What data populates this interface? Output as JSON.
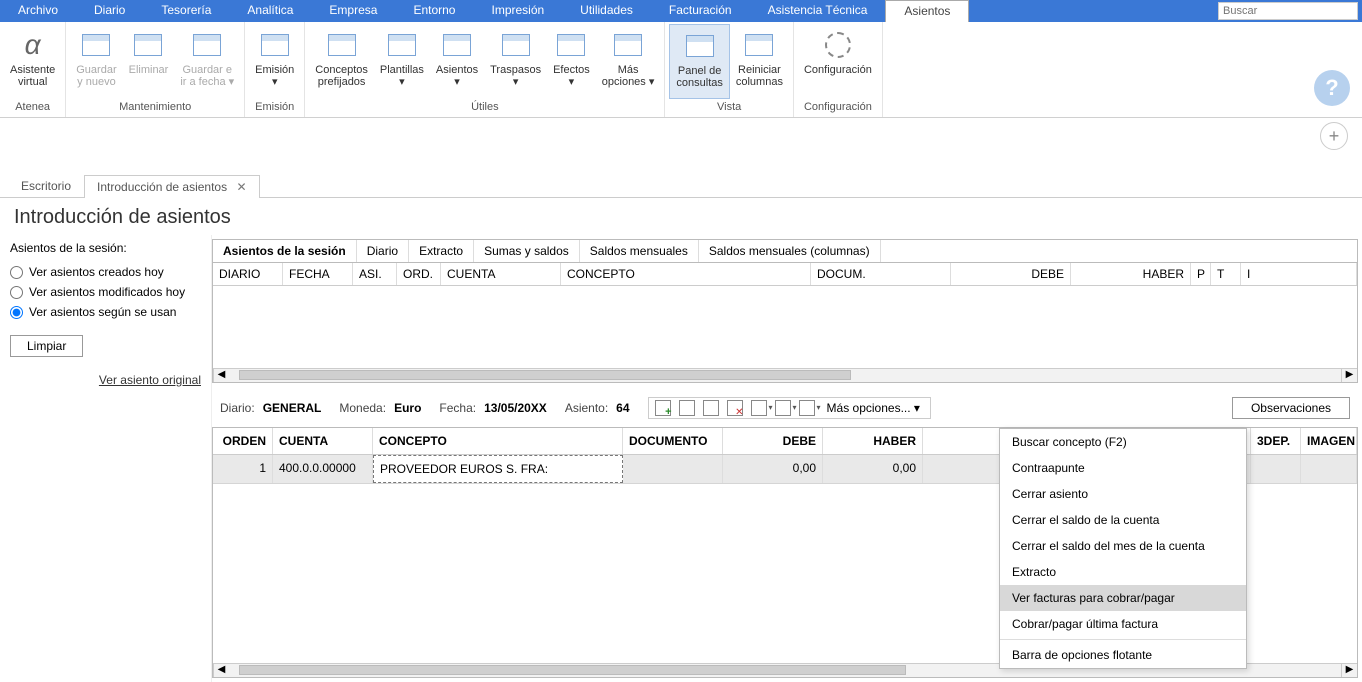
{
  "menubar": {
    "items": [
      "Archivo",
      "Diario",
      "Tesorería",
      "Analítica",
      "Empresa",
      "Entorno",
      "Impresión",
      "Utilidades",
      "Facturación",
      "Asistencia Técnica",
      "Asientos"
    ],
    "active_index": 10,
    "search_placeholder": "Buscar"
  },
  "ribbon": {
    "groups": [
      {
        "label": "Atenea",
        "buttons": [
          {
            "label": "Asistente\nvirtual",
            "icon": "alpha"
          }
        ]
      },
      {
        "label": "Mantenimiento",
        "buttons": [
          {
            "label": "Guardar\ny nuevo",
            "icon": "doc-plus",
            "disabled": true
          },
          {
            "label": "Eliminar",
            "icon": "doc-x",
            "disabled": true
          },
          {
            "label": "Guardar e\nir a fecha ▾",
            "icon": "doc-arrow",
            "disabled": true
          }
        ]
      },
      {
        "label": "Emisión",
        "buttons": [
          {
            "label": "Emisión\n▾",
            "icon": "doc-print"
          }
        ]
      },
      {
        "label": "Útiles",
        "buttons": [
          {
            "label": "Conceptos\nprefijados",
            "icon": "doc-lines"
          },
          {
            "label": "Plantillas\n▾",
            "icon": "doc-template"
          },
          {
            "label": "Asientos\n▾",
            "icon": "doc-asiento"
          },
          {
            "label": "Traspasos\n▾",
            "icon": "cross-arrows"
          },
          {
            "label": "Efectos\n▾",
            "icon": "people"
          },
          {
            "label": "Más\nopciones ▾",
            "icon": "opts"
          }
        ]
      },
      {
        "label": "Vista",
        "buttons": [
          {
            "label": "Panel de\nconsultas",
            "icon": "panel",
            "active": true
          },
          {
            "label": "Reiniciar\ncolumnas",
            "icon": "columns"
          }
        ]
      },
      {
        "label": "Configuración",
        "buttons": [
          {
            "label": "Configuración",
            "icon": "gear"
          }
        ]
      }
    ]
  },
  "secondary_tabs": {
    "items": [
      {
        "label": "Escritorio"
      },
      {
        "label": "Introducción de asientos",
        "closeable": true,
        "active": true
      }
    ]
  },
  "page_title": "Introducción de asientos",
  "side_panel": {
    "title": "Asientos de la sesión:",
    "radios": [
      "Ver asientos creados hoy",
      "Ver asientos modificados hoy",
      "Ver asientos según se usan"
    ],
    "selected_index": 2,
    "clear_btn": "Limpiar",
    "link": "Ver asiento original"
  },
  "inner_tabs": [
    "Asientos de la sesión",
    "Diario",
    "Extracto",
    "Sumas y saldos",
    "Saldos mensuales",
    "Saldos mensuales (columnas)"
  ],
  "top_grid_headers": [
    "DIARIO",
    "FECHA",
    "ASI.",
    "ORD.",
    "CUENTA",
    "CONCEPTO",
    "DOCUM.",
    "DEBE",
    "HABER",
    "P",
    "T",
    "I"
  ],
  "top_grid_widths": [
    70,
    70,
    44,
    44,
    120,
    250,
    140,
    120,
    120,
    20,
    30,
    20
  ],
  "entry_info": {
    "diario_label": "Diario:",
    "diario_value": "GENERAL",
    "moneda_label": "Moneda:",
    "moneda_value": "Euro",
    "fecha_label": "Fecha:",
    "fecha_value": "13/05/20XX",
    "asiento_label": "Asiento:",
    "asiento_value": "64",
    "more_options_label": "Más opciones... ▾",
    "observaciones_btn": "Observaciones"
  },
  "entry_grid": {
    "headers": [
      "ORDEN",
      "CUENTA",
      "CONCEPTO",
      "DOCUMENTO",
      "DEBE",
      "HABER",
      "3DEP.",
      "IMAGEN"
    ],
    "widths": [
      60,
      100,
      250,
      100,
      100,
      100,
      50,
      56
    ],
    "row": {
      "orden": "1",
      "cuenta": "400.0.0.00000",
      "concepto": "PROVEEDOR EUROS S. FRA:",
      "documento": "",
      "debe": "0,00",
      "haber": "0,00"
    }
  },
  "dropdown": {
    "items": [
      "Buscar concepto (F2)",
      "Contraapunte",
      "Cerrar asiento",
      "Cerrar el saldo de la cuenta",
      "Cerrar el saldo del mes de la cuenta",
      "Extracto",
      "Ver facturas para cobrar/pagar",
      "Cobrar/pagar última factura",
      "Barra de opciones flotante"
    ],
    "highlight_index": 6,
    "sep_after_index": 7
  }
}
